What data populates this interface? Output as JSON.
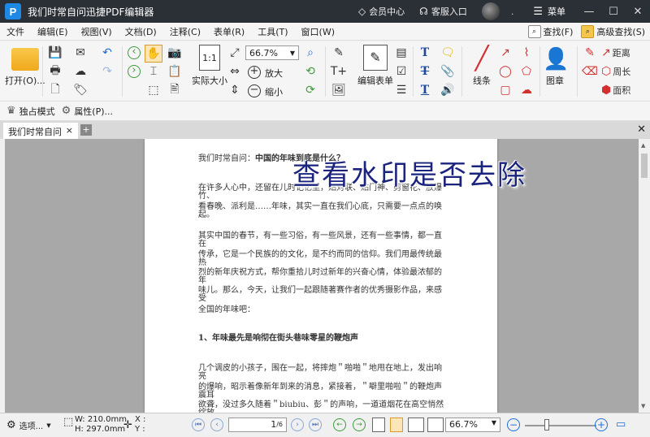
{
  "titlebar": {
    "logo": "P",
    "title": "我们时常自问迅捷PDF编辑器",
    "member_center": "会员中心",
    "customer_entry": "客服入口",
    "dot": ".",
    "menu_label": "菜单"
  },
  "menu": {
    "items": [
      "文件",
      "编辑(E)",
      "视图(V)",
      "文档(D)",
      "注释(C)",
      "表单(R)",
      "工具(T)",
      "窗口(W)"
    ],
    "find": "查找(F)",
    "advanced_find": "高级查找(S)"
  },
  "toolbar": {
    "open_label": "打开(O)...",
    "actual_size_label": "实际大小",
    "zoom_value": "66.7%",
    "zoom_in_label": "放大",
    "zoom_out_label": "缩小",
    "edit_form_label": "编辑表单",
    "line_label": "线条",
    "stamp_label": "图章",
    "distance_label": "距离",
    "perimeter_label": "周长",
    "area_label": "面积"
  },
  "toolbar2": {
    "exclusive_mode": "独占模式",
    "properties": "属性(P)..."
  },
  "tab": {
    "label": "我们时常自问 *",
    "close": "×",
    "add": "+"
  },
  "document": {
    "lines": [
      {
        "prefix": "我们时常自问：",
        "text": "中国的年味到底是什么？"
      },
      {
        "text": "在许多人心中，还留在儿时记忆里，贴对联、贴门神、剪窗花、放爆竹、"
      },
      {
        "text": "看春晚、派利是……年味，其实一直在我们心底，只需要一点点的唤起。"
      },
      {
        "text": "其实中国的春节，有一些习俗，有一些风景，还有一些事情，都一直在"
      },
      {
        "text": "传承，它是一个民族的的文化，是不约而同的信仰。我们用最传统最热"
      },
      {
        "text": "烈的新年庆祝方式，帮你重拾儿时过新年的兴奋心情，体验最浓郁的年"
      },
      {
        "text": "味儿。那么，今天，让我们一起跟随著赛作者的优秀摄影作品，来感受"
      },
      {
        "text": "全国的年味吧："
      },
      {
        "text": "1、年味最先是响彻在街头巷味零星的鞭炮声"
      },
      {
        "text": "几个调皮的小孩子，围在一起，将摔炮＂啪啪＂地甩在地上，发出响亮"
      },
      {
        "text": "的爆响，昭示着像新年到来的消息，紧接着，＂噼里啪啦＂的鞭炮声震耳"
      },
      {
        "text": "欲聋，没过多久随着＂biubiu、彭＂的声响，一道道烟花在高空悄然绽放，"
      }
    ],
    "watermark": "查看水印是否去除"
  },
  "statusbar": {
    "options": "选项...",
    "width": "W: 210.0mm",
    "height": "H: 297.0mm",
    "x": "X :",
    "y": "Y :",
    "page_current": "1",
    "page_total": "/6",
    "zoom_value": "66.7%"
  }
}
